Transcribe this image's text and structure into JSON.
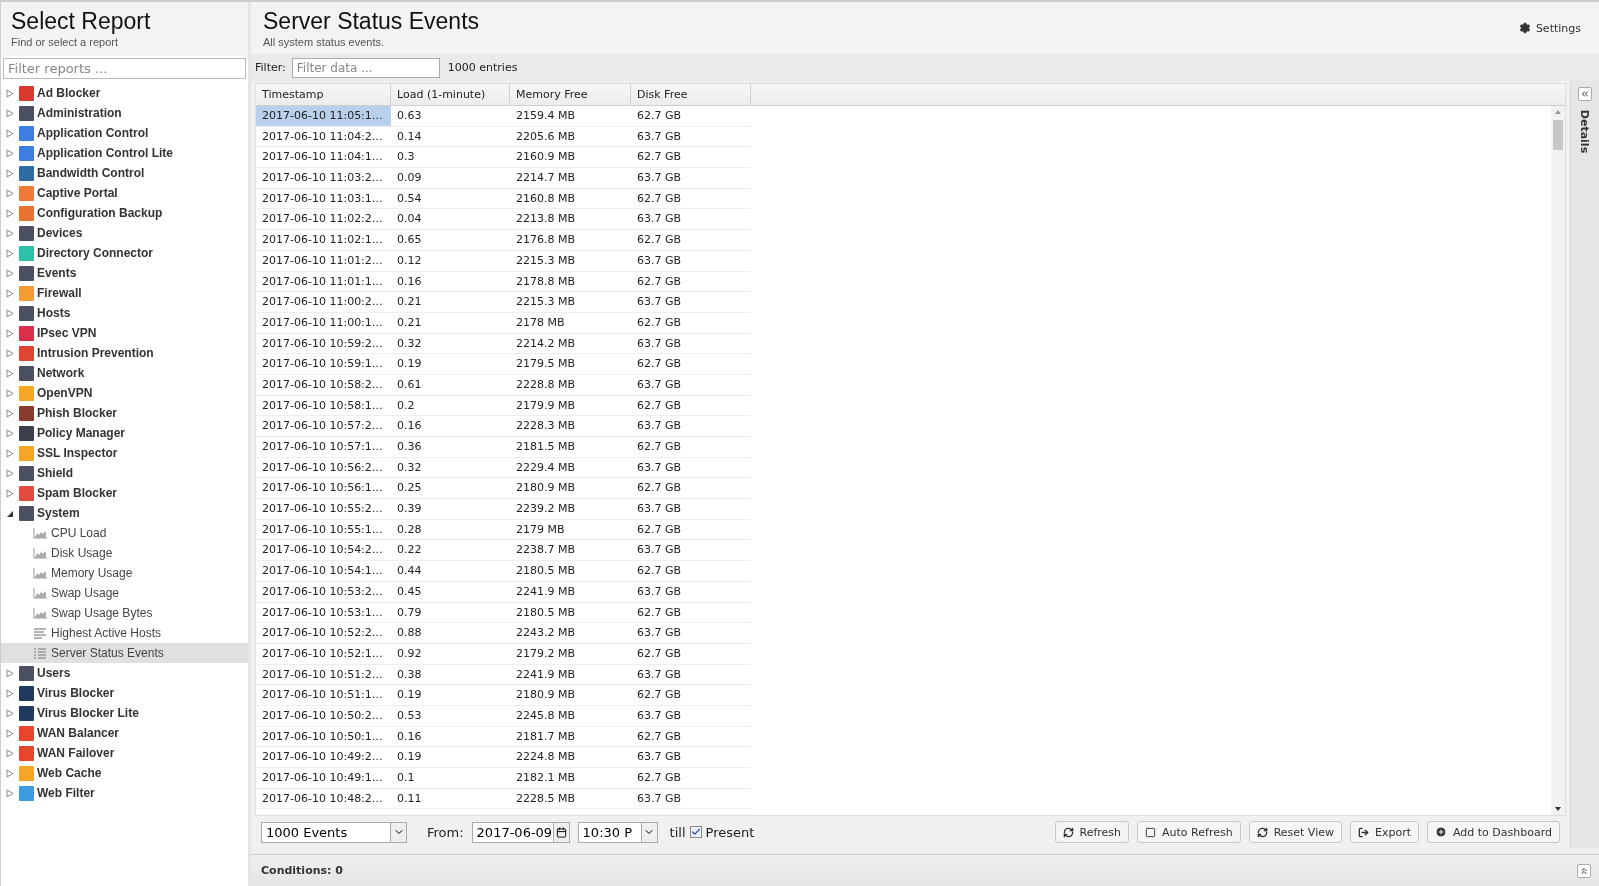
{
  "sidebar": {
    "title": "Select Report",
    "subtitle": "Find or select a report",
    "filter_placeholder": "Filter reports ...",
    "items": [
      {
        "label": "Ad Blocker",
        "color": "#d9392f",
        "expanded": false
      },
      {
        "label": "Administration",
        "color": "#4a5060",
        "expanded": false
      },
      {
        "label": "Application Control",
        "color": "#3d7fe0",
        "expanded": false
      },
      {
        "label": "Application Control Lite",
        "color": "#3d7fe0",
        "expanded": false
      },
      {
        "label": "Bandwidth Control",
        "color": "#2e6da4",
        "expanded": false
      },
      {
        "label": "Captive Portal",
        "color": "#f07a3a",
        "expanded": false
      },
      {
        "label": "Configuration Backup",
        "color": "#e8732e",
        "expanded": false
      },
      {
        "label": "Devices",
        "color": "#4a5060",
        "expanded": false
      },
      {
        "label": "Directory Connector",
        "color": "#2cc1a8",
        "expanded": false
      },
      {
        "label": "Events",
        "color": "#4a5060",
        "expanded": false
      },
      {
        "label": "Firewall",
        "color": "#f39c33",
        "expanded": false
      },
      {
        "label": "Hosts",
        "color": "#4a5060",
        "expanded": false
      },
      {
        "label": "IPsec VPN",
        "color": "#d9304a",
        "expanded": false
      },
      {
        "label": "Intrusion Prevention",
        "color": "#e0452f",
        "expanded": false
      },
      {
        "label": "Network",
        "color": "#4a5060",
        "expanded": false
      },
      {
        "label": "OpenVPN",
        "color": "#f5a623",
        "expanded": false
      },
      {
        "label": "Phish Blocker",
        "color": "#8a3b2b",
        "expanded": false
      },
      {
        "label": "Policy Manager",
        "color": "#3b3f4a",
        "expanded": false
      },
      {
        "label": "SSL Inspector",
        "color": "#f5a623",
        "expanded": false
      },
      {
        "label": "Shield",
        "color": "#4a5060",
        "expanded": false
      },
      {
        "label": "Spam Blocker",
        "color": "#e04a3f",
        "expanded": false
      },
      {
        "label": "System",
        "color": "#4a5060",
        "expanded": true,
        "children": [
          {
            "label": "CPU Load",
            "kind": "area",
            "selected": false
          },
          {
            "label": "Disk Usage",
            "kind": "area",
            "selected": false
          },
          {
            "label": "Memory Usage",
            "kind": "area",
            "selected": false
          },
          {
            "label": "Swap Usage",
            "kind": "area",
            "selected": false
          },
          {
            "label": "Swap Usage Bytes",
            "kind": "area",
            "selected": false
          },
          {
            "label": "Highest Active Hosts",
            "kind": "bars",
            "selected": false
          },
          {
            "label": "Server Status Events",
            "kind": "list",
            "selected": true
          }
        ]
      },
      {
        "label": "Users",
        "color": "#4a5060",
        "expanded": false
      },
      {
        "label": "Virus Blocker",
        "color": "#1f3a5c",
        "expanded": false
      },
      {
        "label": "Virus Blocker Lite",
        "color": "#1f3a5c",
        "expanded": false
      },
      {
        "label": "WAN Balancer",
        "color": "#e8452f",
        "expanded": false
      },
      {
        "label": "WAN Failover",
        "color": "#e8452f",
        "expanded": false
      },
      {
        "label": "Web Cache",
        "color": "#f5a623",
        "expanded": false
      },
      {
        "label": "Web Filter",
        "color": "#3d9be0",
        "expanded": false
      }
    ]
  },
  "main": {
    "title": "Server Status Events",
    "subtitle": "All system status events.",
    "settings_label": "Settings",
    "filter_label": "Filter:",
    "filter_placeholder": "Filter data ...",
    "entries": "1000 entries",
    "table": {
      "columns": [
        "Timestamp",
        "Load (1-minute)",
        "Memory Free",
        "Disk Free"
      ],
      "rows": [
        {
          "cells": [
            "2017-06-10 11:05:1…",
            "0.63",
            "2159.4 MB",
            "62.7 GB"
          ],
          "selected": true
        },
        {
          "cells": [
            "2017-06-10 11:04:2…",
            "0.14",
            "2205.6 MB",
            "63.7 GB"
          ],
          "selected": false
        },
        {
          "cells": [
            "2017-06-10 11:04:1…",
            "0.3",
            "2160.9 MB",
            "62.7 GB"
          ],
          "selected": false
        },
        {
          "cells": [
            "2017-06-10 11:03:2…",
            "0.09",
            "2214.7 MB",
            "63.7 GB"
          ],
          "selected": false
        },
        {
          "cells": [
            "2017-06-10 11:03:1…",
            "0.54",
            "2160.8 MB",
            "62.7 GB"
          ],
          "selected": false
        },
        {
          "cells": [
            "2017-06-10 11:02:2…",
            "0.04",
            "2213.8 MB",
            "63.7 GB"
          ],
          "selected": false
        },
        {
          "cells": [
            "2017-06-10 11:02:1…",
            "0.65",
            "2176.8 MB",
            "62.7 GB"
          ],
          "selected": false
        },
        {
          "cells": [
            "2017-06-10 11:01:2…",
            "0.12",
            "2215.3 MB",
            "63.7 GB"
          ],
          "selected": false
        },
        {
          "cells": [
            "2017-06-10 11:01:1…",
            "0.16",
            "2178.8 MB",
            "62.7 GB"
          ],
          "selected": false
        },
        {
          "cells": [
            "2017-06-10 11:00:2…",
            "0.21",
            "2215.3 MB",
            "63.7 GB"
          ],
          "selected": false
        },
        {
          "cells": [
            "2017-06-10 11:00:1…",
            "0.21",
            "2178 MB",
            "62.7 GB"
          ],
          "selected": false
        },
        {
          "cells": [
            "2017-06-10 10:59:2…",
            "0.32",
            "2214.2 MB",
            "63.7 GB"
          ],
          "selected": false
        },
        {
          "cells": [
            "2017-06-10 10:59:1…",
            "0.19",
            "2179.5 MB",
            "62.7 GB"
          ],
          "selected": false
        },
        {
          "cells": [
            "2017-06-10 10:58:2…",
            "0.61",
            "2228.8 MB",
            "63.7 GB"
          ],
          "selected": false
        },
        {
          "cells": [
            "2017-06-10 10:58:1…",
            "0.2",
            "2179.9 MB",
            "62.7 GB"
          ],
          "selected": false
        },
        {
          "cells": [
            "2017-06-10 10:57:2…",
            "0.16",
            "2228.3 MB",
            "63.7 GB"
          ],
          "selected": false
        },
        {
          "cells": [
            "2017-06-10 10:57:1…",
            "0.36",
            "2181.5 MB",
            "62.7 GB"
          ],
          "selected": false
        },
        {
          "cells": [
            "2017-06-10 10:56:2…",
            "0.32",
            "2229.4 MB",
            "63.7 GB"
          ],
          "selected": false
        },
        {
          "cells": [
            "2017-06-10 10:56:1…",
            "0.25",
            "2180.9 MB",
            "62.7 GB"
          ],
          "selected": false
        },
        {
          "cells": [
            "2017-06-10 10:55:2…",
            "0.39",
            "2239.2 MB",
            "63.7 GB"
          ],
          "selected": false
        },
        {
          "cells": [
            "2017-06-10 10:55:1…",
            "0.28",
            "2179 MB",
            "62.7 GB"
          ],
          "selected": false
        },
        {
          "cells": [
            "2017-06-10 10:54:2…",
            "0.22",
            "2238.7 MB",
            "63.7 GB"
          ],
          "selected": false
        },
        {
          "cells": [
            "2017-06-10 10:54:1…",
            "0.44",
            "2180.5 MB",
            "62.7 GB"
          ],
          "selected": false
        },
        {
          "cells": [
            "2017-06-10 10:53:2…",
            "0.45",
            "2241.9 MB",
            "63.7 GB"
          ],
          "selected": false
        },
        {
          "cells": [
            "2017-06-10 10:53:1…",
            "0.79",
            "2180.5 MB",
            "62.7 GB"
          ],
          "selected": false
        },
        {
          "cells": [
            "2017-06-10 10:52:2…",
            "0.88",
            "2243.2 MB",
            "63.7 GB"
          ],
          "selected": false
        },
        {
          "cells": [
            "2017-06-10 10:52:1…",
            "0.92",
            "2179.2 MB",
            "62.7 GB"
          ],
          "selected": false
        },
        {
          "cells": [
            "2017-06-10 10:51:2…",
            "0.38",
            "2241.9 MB",
            "63.7 GB"
          ],
          "selected": false
        },
        {
          "cells": [
            "2017-06-10 10:51:1…",
            "0.19",
            "2180.9 MB",
            "62.7 GB"
          ],
          "selected": false
        },
        {
          "cells": [
            "2017-06-10 10:50:2…",
            "0.53",
            "2245.8 MB",
            "63.7 GB"
          ],
          "selected": false
        },
        {
          "cells": [
            "2017-06-10 10:50:1…",
            "0.16",
            "2181.7 MB",
            "62.7 GB"
          ],
          "selected": false
        },
        {
          "cells": [
            "2017-06-10 10:49:2…",
            "0.19",
            "2224.8 MB",
            "63.7 GB"
          ],
          "selected": false
        },
        {
          "cells": [
            "2017-06-10 10:49:1…",
            "0.1",
            "2182.1 MB",
            "62.7 GB"
          ],
          "selected": false
        },
        {
          "cells": [
            "2017-06-10 10:48:2…",
            "0.11",
            "2228.5 MB",
            "63.7 GB"
          ],
          "selected": false
        }
      ]
    },
    "toolbar": {
      "limit": "1000 Events",
      "from_label": "From:",
      "date": "2017-06-09",
      "time": "10:30 P",
      "till_label": "till",
      "present_checked": true,
      "present_label": "Present",
      "buttons": [
        {
          "label": "Refresh",
          "kind": "refresh"
        },
        {
          "label": "Auto Refresh",
          "kind": "toggle"
        },
        {
          "label": "Reset View",
          "kind": "refresh"
        },
        {
          "label": "Export",
          "kind": "export"
        },
        {
          "label": "Add to Dashboard",
          "kind": "add"
        }
      ]
    },
    "conditions": "Conditions: 0",
    "details_label": "Details"
  }
}
